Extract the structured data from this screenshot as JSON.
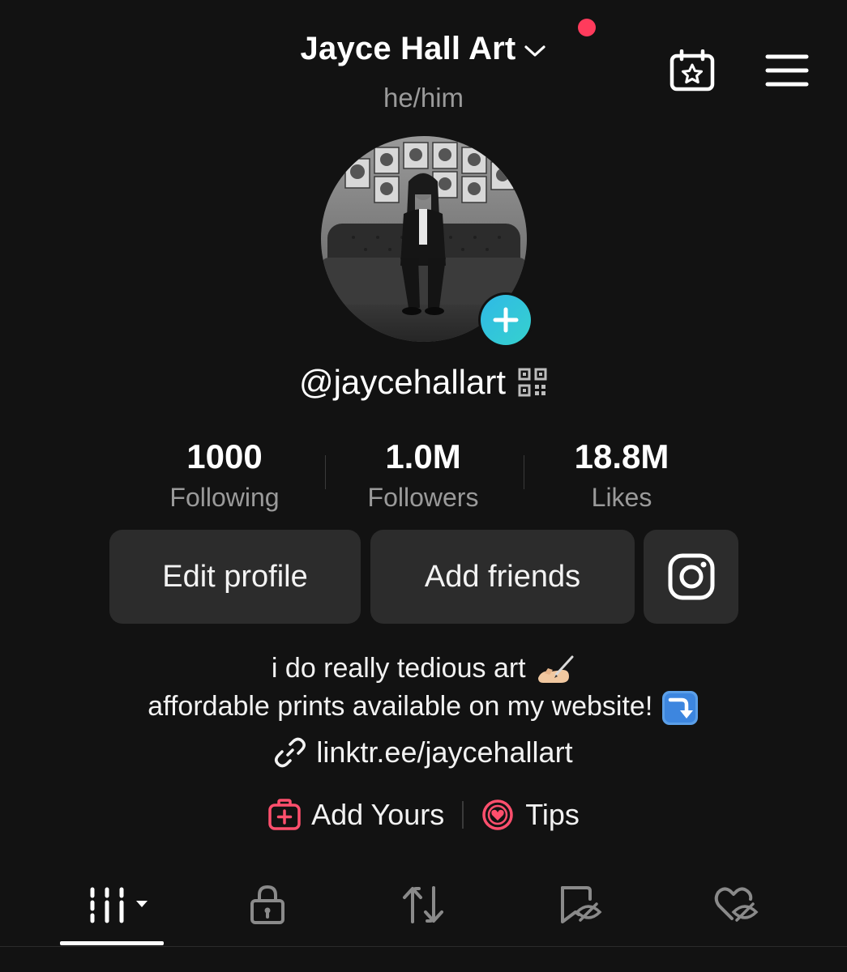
{
  "header": {
    "title": "Jayce Hall Art",
    "pronouns": "he/him",
    "icons": [
      "chevron-down-icon",
      "calendar-star-icon",
      "hamburger-menu-icon"
    ],
    "notification_color": "#ff3b5c"
  },
  "profile": {
    "username": "@jaycehallart",
    "avatar_add_color": "#2fb9e6"
  },
  "stats": [
    {
      "value": "1000",
      "label": "Following"
    },
    {
      "value": "1.0M",
      "label": "Followers"
    },
    {
      "value": "18.8M",
      "label": "Likes"
    }
  ],
  "buttons": {
    "edit_profile": "Edit profile",
    "add_friends": "Add friends",
    "instagram_icon": "instagram-icon"
  },
  "bio": {
    "line1": "i do really tedious art",
    "line2": "affordable prints available on my website!",
    "link": "linktr.ee/jaycehallart"
  },
  "extras": {
    "add_yours": "Add Yours",
    "tips": "Tips",
    "accent_color": "#ff4f6d"
  },
  "tabs": [
    {
      "icon": "videos-grid-icon",
      "active": true
    },
    {
      "icon": "lock-icon",
      "active": false
    },
    {
      "icon": "repost-icon",
      "active": false
    },
    {
      "icon": "bookmark-hidden-icon",
      "active": false
    },
    {
      "icon": "liked-hidden-icon",
      "active": false
    }
  ]
}
